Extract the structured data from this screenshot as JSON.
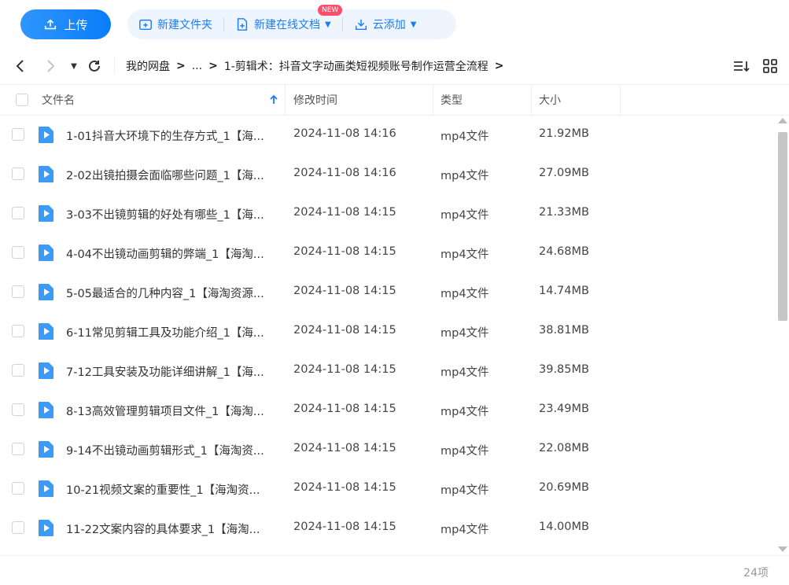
{
  "toolbar": {
    "upload_label": "上传",
    "new_folder_label": "新建文件夹",
    "new_online_doc_label": "新建在线文档",
    "new_badge": "NEW",
    "cloud_add_label": "云添加",
    "accent": "#0a7cf7"
  },
  "breadcrumb": {
    "root": "我的网盘",
    "ellipsis": "...",
    "current": "1-剪辑术：抖音文字动画类短视频账号制作运营全流程"
  },
  "table": {
    "headers": {
      "name": "文件名",
      "mtime": "修改时间",
      "type": "类型",
      "size": "大小"
    },
    "rows": [
      {
        "name": "1-01抖音大环境下的生存方式_1【海...",
        "mtime": "2024-11-08 14:16",
        "type": "mp4文件",
        "size": "21.92MB"
      },
      {
        "name": "2-02出镜拍摄会面临哪些问题_1【海...",
        "mtime": "2024-11-08 14:16",
        "type": "mp4文件",
        "size": "27.09MB"
      },
      {
        "name": "3-03不出镜剪辑的好处有哪些_1【海...",
        "mtime": "2024-11-08 14:15",
        "type": "mp4文件",
        "size": "21.33MB"
      },
      {
        "name": "4-04不出镜动画剪辑的弊端_1【海淘...",
        "mtime": "2024-11-08 14:15",
        "type": "mp4文件",
        "size": "24.68MB"
      },
      {
        "name": "5-05最适合的几种内容_1【海淘资源...",
        "mtime": "2024-11-08 14:15",
        "type": "mp4文件",
        "size": "14.74MB"
      },
      {
        "name": "6-11常见剪辑工具及功能介绍_1【海...",
        "mtime": "2024-11-08 14:15",
        "type": "mp4文件",
        "size": "38.81MB"
      },
      {
        "name": "7-12工具安装及功能详细讲解_1【海...",
        "mtime": "2024-11-08 14:15",
        "type": "mp4文件",
        "size": "39.85MB"
      },
      {
        "name": "8-13高效管理剪辑项目文件_1【海淘...",
        "mtime": "2024-11-08 14:15",
        "type": "mp4文件",
        "size": "23.49MB"
      },
      {
        "name": "9-14不出镜动画剪辑形式_1【海淘资...",
        "mtime": "2024-11-08 14:15",
        "type": "mp4文件",
        "size": "22.08MB"
      },
      {
        "name": "10-21视频文案的重要性_1【海淘资...",
        "mtime": "2024-11-08 14:15",
        "type": "mp4文件",
        "size": "20.69MB"
      },
      {
        "name": "11-22文案内容的具体要求_1【海淘...",
        "mtime": "2024-11-08 14:15",
        "type": "mp4文件",
        "size": "14.00MB"
      }
    ]
  },
  "footer": {
    "item_count": "24项"
  }
}
